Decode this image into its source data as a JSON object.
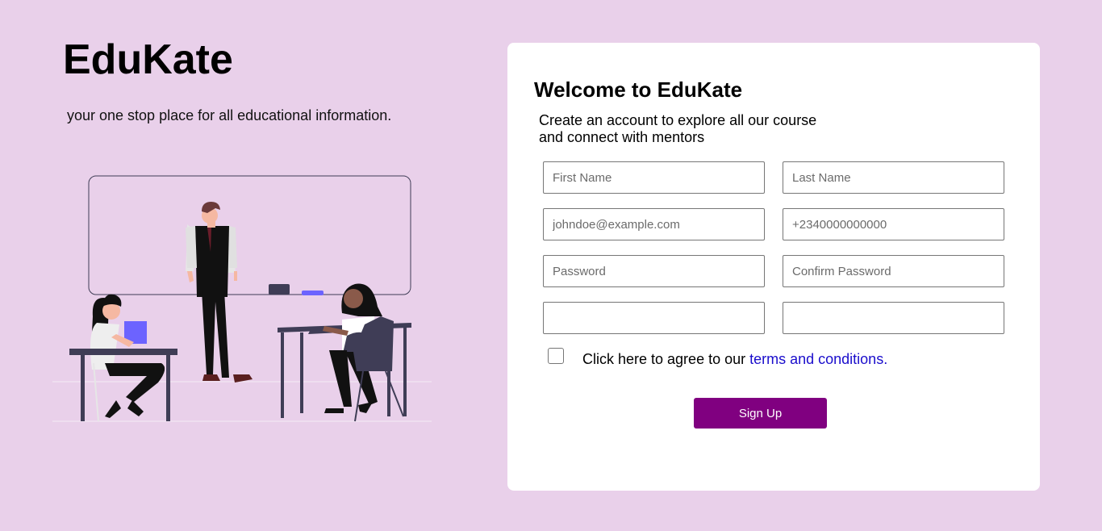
{
  "brand": {
    "name": "EduKate",
    "tagline": "your one stop place for all educational information."
  },
  "form": {
    "title": "Welcome to EduKate",
    "subtitle_line1": "Create an account to explore all our course",
    "subtitle_line2": "and connect with mentors",
    "fields": {
      "first_name": {
        "placeholder": "First Name",
        "value": ""
      },
      "last_name": {
        "placeholder": "Last Name",
        "value": ""
      },
      "email": {
        "placeholder": "johndoe@example.com",
        "value": ""
      },
      "phone": {
        "placeholder": "+2340000000000",
        "value": ""
      },
      "password": {
        "placeholder": "Password",
        "value": ""
      },
      "confirm_password": {
        "placeholder": "Confirm Password",
        "value": ""
      },
      "extra_left": {
        "placeholder": "",
        "value": ""
      },
      "extra_right": {
        "placeholder": "",
        "value": ""
      }
    },
    "agree_prefix": "Click here to agree to our ",
    "agree_link": "terms and conditions.",
    "agree_checked": false,
    "submit_label": "Sign Up"
  },
  "colors": {
    "page_background": "#e9d0ea",
    "card_background": "#ffffff",
    "primary_button": "#800080",
    "link": "#1a0dcc",
    "illustration_accent": "#6c63ff",
    "illustration_dark": "#3f3d56"
  },
  "illustration": {
    "name": "classroom-illustration"
  }
}
